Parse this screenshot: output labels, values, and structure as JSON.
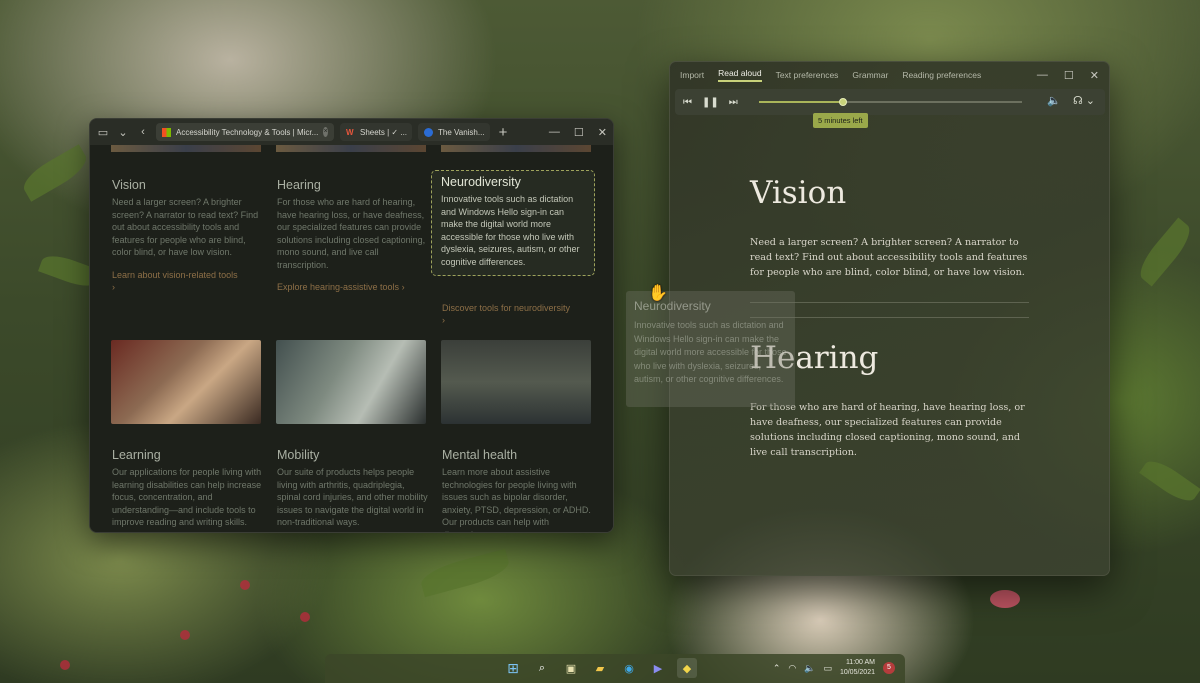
{
  "edge": {
    "tabs": [
      {
        "label": "Accessibility Technology & Tools | Micr...",
        "active": true
      },
      {
        "label": "Sheets | ✓ ...",
        "active": false
      },
      {
        "label": "The Vanish...",
        "active": false
      }
    ],
    "cards_top": [
      {
        "title": "Vision",
        "body": "Need a larger screen? A brighter screen? A narrator to read text? Find out about accessibility tools and features for people who are blind, color blind, or have low vision.",
        "link": "Learn about vision-related tools"
      },
      {
        "title": "Hearing",
        "body": "For those who are hard of hearing, have hearing loss, or have deafness, our specialized features can provide solutions including closed captioning, mono sound, and live call transcription.",
        "link": "Explore hearing-assistive tools"
      },
      {
        "title": "Neurodiversity",
        "body": "Innovative tools such as dictation and Windows Hello sign-in can make the digital world more accessible for those who live with dyslexia, seizures, autism, or other cognitive differences.",
        "link": "Discover tools for neurodiversity"
      }
    ],
    "cards_bottom": [
      {
        "title": "Learning",
        "body": "Our applications for people living with learning disabilities can help increase focus, concentration, and understanding—and include tools to improve reading and writing skills."
      },
      {
        "title": "Mobility",
        "body": "Our suite of products helps people living with arthritis, quadriplegia, spinal cord injuries, and other mobility issues to navigate the digital world in non-traditional ways."
      },
      {
        "title": "Mental health",
        "body": "Learn more about assistive technologies for people living with issues such as bipolar disorder, anxiety, PTSD, depression, or ADHD. Our products can help with distraction."
      }
    ]
  },
  "reader": {
    "menu": [
      "Import",
      "Read aloud",
      "Text preferences",
      "Grammar",
      "Reading preferences"
    ],
    "active_menu": "Read aloud",
    "progress": 0.32,
    "time_left": "5 minutes left",
    "sections": [
      {
        "heading": "Vision",
        "body": "Need a larger screen? A brighter screen? A narrator to read text? Find out about accessibility tools and features for people who are blind, color blind, or have low vision."
      },
      {
        "heading": "Hearing",
        "body": "For those who are hard of hearing, have hearing loss, or have deafness, our specialized features can provide solutions including closed captioning, mono sound, and live call transcription."
      }
    ]
  },
  "drag_ghost": {
    "title": "Neurodiversity",
    "body": "Innovative tools such as dictation and Windows Hello sign-in can make the digital world more accessible for those who live with dyslexia, seizures, autism, or other cognitive differences."
  },
  "taskbar": {
    "time": "11:00 AM",
    "date": "10/05/2021",
    "notifications": "5"
  },
  "colors": {
    "accent": "#c8d27a",
    "link": "#8d6f47"
  }
}
